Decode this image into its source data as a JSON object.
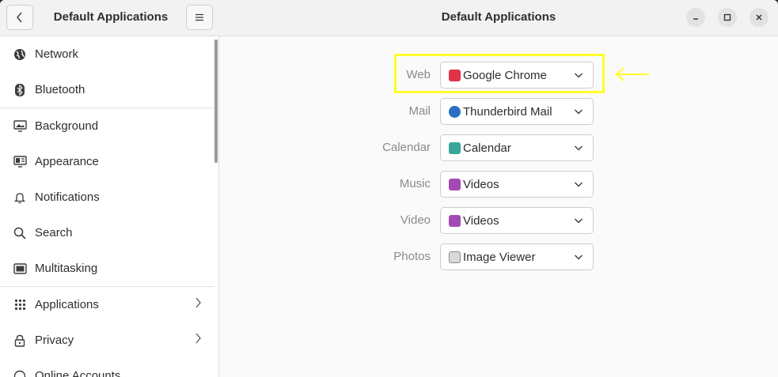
{
  "sidebar": {
    "title": "Default Applications",
    "items": [
      {
        "label": "Network",
        "icon": "globe-icon"
      },
      {
        "label": "Bluetooth",
        "icon": "bluetooth-icon"
      },
      {
        "label": "Background",
        "icon": "monitor-icon"
      },
      {
        "label": "Appearance",
        "icon": "appearance-icon"
      },
      {
        "label": "Notifications",
        "icon": "bell-icon"
      },
      {
        "label": "Search",
        "icon": "search-icon"
      },
      {
        "label": "Multitasking",
        "icon": "multitasking-icon"
      },
      {
        "label": "Applications",
        "icon": "applications-icon"
      },
      {
        "label": "Privacy",
        "icon": "lock-icon"
      },
      {
        "label": "Online Accounts",
        "icon": "accounts-icon"
      }
    ]
  },
  "main": {
    "title": "Default Applications",
    "rows": [
      {
        "label": "Web",
        "value": "Google Chrome",
        "icon_color": "#e0334a"
      },
      {
        "label": "Mail",
        "value": "Thunderbird Mail",
        "icon_color": "#2a6fc4"
      },
      {
        "label": "Calendar",
        "value": "Calendar",
        "icon_color": "#3aa59a"
      },
      {
        "label": "Music",
        "value": "Videos",
        "icon_color": "#a44ab5"
      },
      {
        "label": "Video",
        "value": "Videos",
        "icon_color": "#a44ab5"
      },
      {
        "label": "Photos",
        "value": "Image Viewer",
        "icon_color": "#8a8a8a"
      }
    ]
  },
  "annotation": {
    "color": "#ffff2a"
  }
}
